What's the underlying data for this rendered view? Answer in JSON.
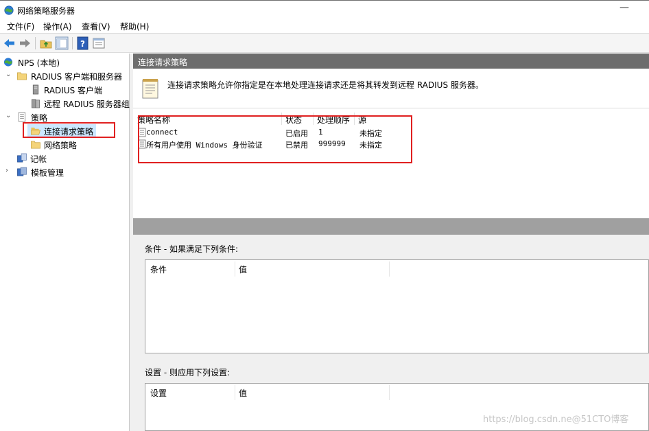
{
  "window": {
    "title": "网络策略服务器",
    "minimize_glyph": "—"
  },
  "menubar": {
    "items": [
      "文件(F)",
      "操作(A)",
      "查看(V)",
      "帮助(H)"
    ]
  },
  "toolbar": {
    "buttons": [
      "back-arrow-icon",
      "forward-arrow-icon",
      "up-folder-icon",
      "show-hide-tree-icon",
      "help-icon",
      "properties-icon"
    ]
  },
  "tree": {
    "items": [
      {
        "label": "NPS (本地)",
        "icon": "globe-server-icon"
      },
      {
        "label": "RADIUS 客户端和服务器",
        "icon": "folder-icon",
        "expanded": true
      },
      {
        "label": "RADIUS 客户端",
        "icon": "server-icon"
      },
      {
        "label": "远程 RADIUS 服务器组",
        "icon": "server-group-icon"
      },
      {
        "label": "策略",
        "icon": "policy-doc-icon",
        "expanded": true
      },
      {
        "label": "连接请求策略",
        "icon": "open-folder-icon",
        "selected": true
      },
      {
        "label": "网络策略",
        "icon": "folder-icon"
      },
      {
        "label": "记帐",
        "icon": "accounting-icon"
      },
      {
        "label": "模板管理",
        "icon": "templates-icon",
        "expanded": false
      }
    ]
  },
  "main": {
    "header": "连接请求策略",
    "description": "连接请求策略允许你指定是在本地处理连接请求还是将其转发到远程 RADIUS 服务器。",
    "columns": [
      "策略名称",
      "状态",
      "处理顺序",
      "源"
    ],
    "rows": [
      {
        "name": "connect",
        "status": "已启用",
        "order": "1",
        "source": "未指定"
      },
      {
        "name": "所有用户使用 Windows 身份验证",
        "status": "已禁用",
        "order": "999999",
        "source": "未指定"
      }
    ],
    "conditions_label": "条件 - 如果满足下列条件:",
    "conditions_columns": [
      "条件",
      "值"
    ],
    "settings_label": "设置 - 则应用下列设置:",
    "settings_columns": [
      "设置",
      "值"
    ]
  },
  "watermark": "https://blog.csdn.ne@51CTO博客",
  "colors": {
    "section_header": "#6d6d6d",
    "selection": "#cce8ff",
    "highlight_box": "#e02020",
    "gray_band": "#a0a0a0"
  }
}
